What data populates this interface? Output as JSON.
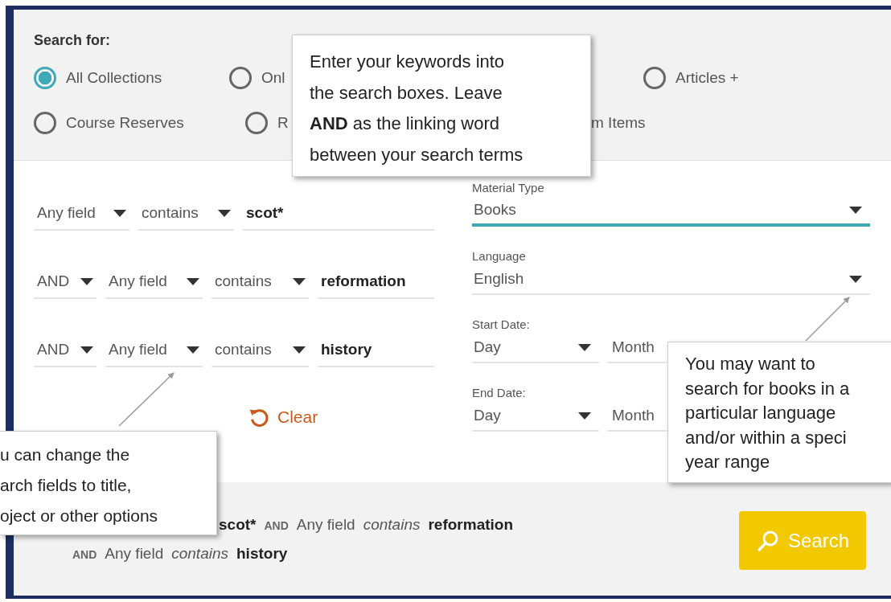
{
  "search_for": {
    "label": "Search for:",
    "rows": [
      [
        {
          "label": "All Collections",
          "selected": true
        },
        {
          "label": "Onl",
          "selected": false
        },
        {
          "label": "Articles +",
          "selected": false
        }
      ],
      [
        {
          "label": "Course Reserves",
          "selected": false
        },
        {
          "label": "R",
          "selected": false
        },
        {
          "label": "m Items"
        }
      ]
    ]
  },
  "query_rows": [
    {
      "field": "Any field",
      "condition": "contains",
      "term": "scot*"
    },
    {
      "operator": "AND",
      "field": "Any field",
      "condition": "contains",
      "term": "reformation"
    },
    {
      "operator": "AND",
      "field": "Any field",
      "condition": "contains",
      "term": "history"
    }
  ],
  "clear_button": "Clear",
  "filters": [
    {
      "kind": "select",
      "label": "Material Type",
      "value": "Books",
      "focused": true
    },
    {
      "kind": "select",
      "label": "Language",
      "value": "English",
      "focused": false
    },
    {
      "kind": "date",
      "label": "Start Date:",
      "day": "Day",
      "month": "Month"
    },
    {
      "kind": "date",
      "label": "End Date:",
      "day": "Day",
      "month": "Month"
    }
  ],
  "summary": [
    [
      {
        "kind": "term",
        "text": "scot*"
      },
      {
        "kind": "op",
        "text": "AND"
      },
      {
        "kind": "field",
        "text": "Any field"
      },
      {
        "kind": "cond",
        "text": "contains"
      },
      {
        "kind": "term",
        "text": "reformation"
      }
    ],
    [
      {
        "kind": "op",
        "text": "AND"
      },
      {
        "kind": "field",
        "text": "Any field"
      },
      {
        "kind": "cond",
        "text": "contains"
      },
      {
        "kind": "term",
        "text": "history"
      }
    ]
  ],
  "search_button": "Search",
  "callouts": [
    {
      "text": "Enter your keywords into\nthe search boxes. Leave\n**AND** as the linking word\nbetween your search terms"
    },
    {
      "text": "u can change the\narch fields to title,\noject or other options"
    },
    {
      "text": "You may want to\nsearch for books in a\nparticular language\nand/or within a speci\nyear range"
    }
  ]
}
